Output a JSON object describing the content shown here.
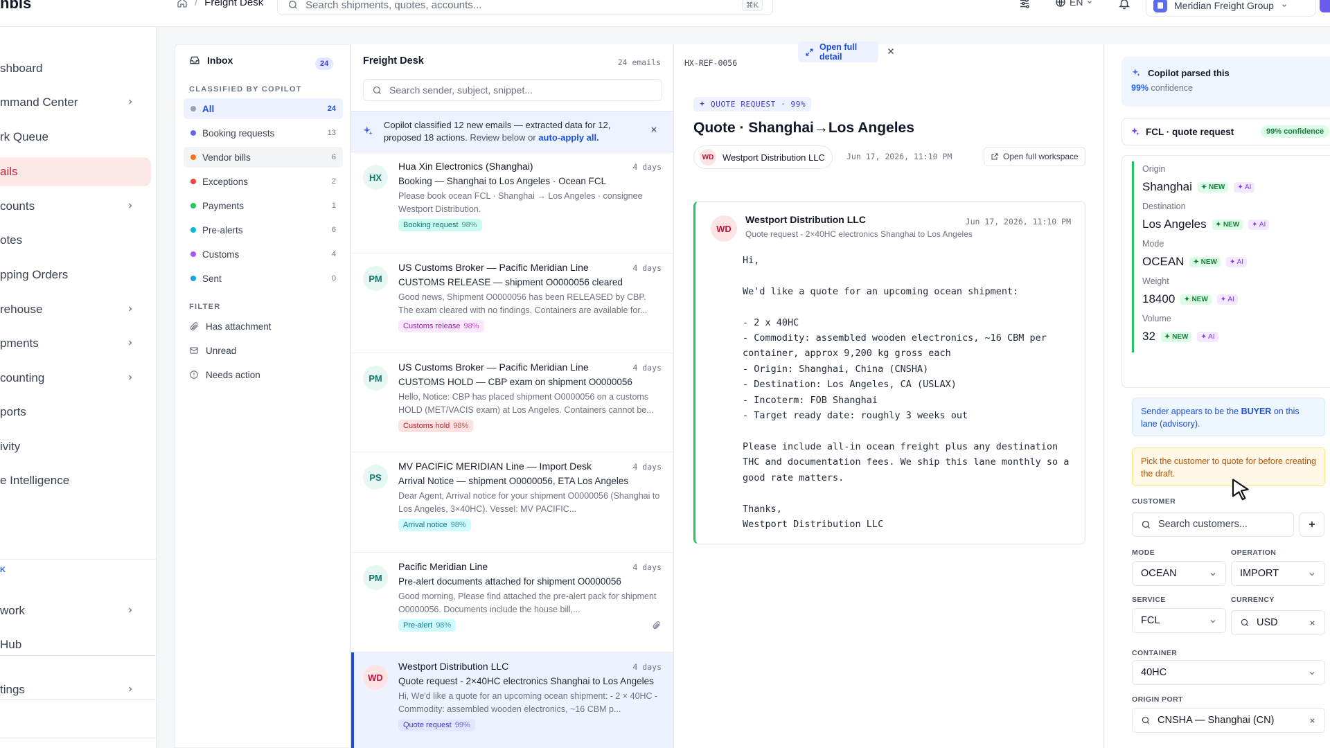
{
  "topbar": {
    "logo": "nbis",
    "breadcrumb_current": "Freight Desk",
    "search_placeholder": "Search shipments, quotes, accounts...",
    "search_shortcut": "⌘K",
    "language": "EN",
    "org_name": "Meridian Freight Group"
  },
  "nav": {
    "items": [
      {
        "label": "shboard",
        "chevron": false,
        "active": false
      },
      {
        "label": "mmand Center",
        "chevron": true,
        "active": false
      },
      {
        "label": "rk Queue",
        "chevron": false,
        "active": false
      },
      {
        "label": "ails",
        "chevron": false,
        "active": true
      },
      {
        "label": "counts",
        "chevron": true,
        "active": false
      },
      {
        "label": "otes",
        "chevron": false,
        "active": false
      },
      {
        "label": "pping Orders",
        "chevron": false,
        "active": false
      },
      {
        "label": "rehouse",
        "chevron": true,
        "active": false
      },
      {
        "label": "pments",
        "chevron": true,
        "active": false
      },
      {
        "label": "counting",
        "chevron": true,
        "active": false
      },
      {
        "label": "ports",
        "chevron": false,
        "active": false
      },
      {
        "label": "ivity",
        "chevron": false,
        "active": false
      },
      {
        "label": "e Intelligence",
        "chevron": false,
        "active": false
      }
    ],
    "section_label": "K",
    "lower_items": [
      {
        "label": "work",
        "chevron": true
      },
      {
        "label": "Hub",
        "chevron": false
      },
      {
        "label": "tings",
        "chevron": true
      }
    ]
  },
  "folders": {
    "inbox_label": "Inbox",
    "inbox_count": "24",
    "classified_label": "CLASSIFIED BY COPILOT",
    "items": [
      {
        "label": "All",
        "count": "24",
        "color": "#9ca3af"
      },
      {
        "label": "Booking requests",
        "count": "13",
        "color": "#6366f1"
      },
      {
        "label": "Vendor bills",
        "count": "6",
        "color": "#f97316"
      },
      {
        "label": "Exceptions",
        "count": "2",
        "color": "#ef4444"
      },
      {
        "label": "Payments",
        "count": "1",
        "color": "#22c55e"
      },
      {
        "label": "Pre-alerts",
        "count": "6",
        "color": "#06b6d4"
      },
      {
        "label": "Customs",
        "count": "4",
        "color": "#a855f7"
      },
      {
        "label": "Sent",
        "count": "0",
        "color": "#0ea5e9"
      }
    ],
    "filter_label": "FILTER",
    "filters": [
      "Has attachment",
      "Unread",
      "Needs action"
    ]
  },
  "email_list": {
    "title": "Freight Desk",
    "count": "24 emails",
    "search_placeholder": "Search sender, subject, snippet...",
    "banner": {
      "text1": "Copilot classified 12 new emails — extracted data for 12, proposed 18 actions.",
      "text2": "Review below or",
      "link": "auto-apply all."
    },
    "emails": [
      {
        "initials": "HX",
        "from": "Hua Xin Electronics (Shanghai)",
        "age": "4 days",
        "subject": "Booking — Shanghai to Los Angeles · Ocean FCL",
        "snippet": "Please book ocean FCL · Shanghai → Los Angeles · consignee Westport Distribution.",
        "tag": "Booking request",
        "pct": "98%",
        "tag_bg": "#ccfbf1",
        "tag_fg": "#0f766e",
        "av_bg": "#e6f7f4",
        "av_fg": "#0f766e"
      },
      {
        "initials": "PM",
        "from": "US Customs Broker — Pacific Meridian Line",
        "age": "4 days",
        "subject": "CUSTOMS RELEASE — shipment O0000056 cleared",
        "snippet": "Good news, Shipment O0000056 has been RELEASED by CBP. The exam cleared with no findings. Containers are available for...",
        "tag": "Customs release",
        "pct": "98%",
        "tag_bg": "#fae8ff",
        "tag_fg": "#a21caf",
        "av_bg": "#e6f7f4",
        "av_fg": "#0f766e"
      },
      {
        "initials": "PM",
        "from": "US Customs Broker — Pacific Meridian Line",
        "age": "4 days",
        "subject": "CUSTOMS HOLD — CBP exam on shipment O0000056",
        "snippet": "Hello, Notice: CBP has placed shipment O0000056 on a customs HOLD (MET/VACIS exam) at Los Angeles. Containers cannot be...",
        "tag": "Customs hold",
        "pct": "98%",
        "tag_bg": "#fee2e2",
        "tag_fg": "#b91c1c",
        "av_bg": "#e6f7f4",
        "av_fg": "#0f766e"
      },
      {
        "initials": "PS",
        "from": "MV PACIFIC MERIDIAN Line — Import Desk",
        "age": "4 days",
        "subject": "Arrival Notice — shipment O0000056, ETA Los Angeles",
        "snippet": "Dear Agent, Arrival notice for your shipment O0000056 (Shanghai to Los Angeles, 3×40HC). Vessel: MV PACIFIC...",
        "tag": "Arrival notice",
        "pct": "98%",
        "tag_bg": "#cffafe",
        "tag_fg": "#0e7490",
        "av_bg": "#e6f7f4",
        "av_fg": "#0f766e"
      },
      {
        "initials": "PM",
        "from": "Pacific Meridian Line",
        "age": "4 days",
        "subject": "Pre-alert documents attached for shipment O0000056",
        "snippet": "Good morning, Please find attached the pre-alert pack for shipment O0000056. Documents include the house bill,...",
        "tag": "Pre-alert",
        "pct": "98%",
        "tag_bg": "#cffafe",
        "tag_fg": "#0e7490",
        "av_bg": "#e6f7f4",
        "av_fg": "#0f766e",
        "attachment": true
      },
      {
        "initials": "WD",
        "from": "Westport Distribution LLC",
        "age": "4 days",
        "subject": "Quote request - 2×40HC electronics Shanghai to Los Angeles",
        "snippet": "Hi, We'd like a quote for an upcoming ocean shipment: - 2 × 40HC - Commodity: assembled wooden electronics, ~16 CBM p...",
        "tag": "Quote request",
        "pct": "99%",
        "tag_bg": "#e0e7ff",
        "tag_fg": "#4338ca",
        "av_bg": "#fde4e4",
        "av_fg": "#be123c",
        "selected": true
      }
    ]
  },
  "detail": {
    "ref": "HX-REF-0056",
    "open_full_detail": "Open full detail",
    "tag": "QUOTE REQUEST · 99%",
    "title": "Quote · Shanghai→Los Angeles",
    "sender_initials": "WD",
    "sender": "Westport Distribution LLC",
    "date": "Jun 17, 2026, 11:10 PM",
    "open_workspace": "Open full workspace",
    "message": {
      "initials": "WD",
      "from": "Westport Distribution LLC",
      "subject": "Quote request - 2×40HC electronics Shanghai to Los Angeles",
      "date": "Jun 17, 2026, 11:10 PM",
      "body": "Hi,\n\nWe'd like a quote for an upcoming ocean shipment:\n\n- 2 x 40HC\n- Commodity: assembled wooden electronics, ~16 CBM per container, approx 9,200 kg gross each\n- Origin: Shanghai, China (CNSHA)\n- Destination: Los Angeles, CA (USLAX)\n- Incoterm: FOB Shanghai\n- Target ready date: roughly 3 weeks out\n\nPlease include all-in ocean freight plus any destination THC and documentation fees. We ship this lane monthly so a good rate matters.\n\nThanks,\nWestport Distribution LLC"
    }
  },
  "copilot": {
    "parsed_title": "Copilot parsed this",
    "parsed_pct": "99%",
    "parsed_suffix": "confidence",
    "type_label": "FCL · quote request",
    "type_confidence": "99% confidence",
    "new_badge": "NEW",
    "ai_badge": "AI",
    "fields": [
      {
        "label": "Origin",
        "value": "Shanghai"
      },
      {
        "label": "Destination",
        "value": "Los Angeles"
      },
      {
        "label": "Mode",
        "value": "OCEAN"
      },
      {
        "label": "Weight",
        "value": "18400"
      },
      {
        "label": "Volume",
        "value": "32"
      }
    ],
    "buyer_pre": "Sender appears to be the",
    "buyer_bold": "BUYER",
    "buyer_post": "on this lane (advisory).",
    "pick_note": "Pick the customer to quote for before creating the draft.",
    "form": {
      "customer_label": "CUSTOMER",
      "customer_placeholder": "Search customers...",
      "mode_label": "MODE",
      "mode_value": "OCEAN",
      "operation_label": "OPERATION",
      "operation_value": "IMPORT",
      "service_label": "SERVICE",
      "service_value": "FCL",
      "currency_label": "CURRENCY",
      "currency_value": "USD",
      "container_label": "CONTAINER",
      "container_value": "40HC",
      "origin_port_label": "ORIGIN PORT",
      "origin_port_value": "CNSHA — Shanghai (CN)"
    }
  }
}
